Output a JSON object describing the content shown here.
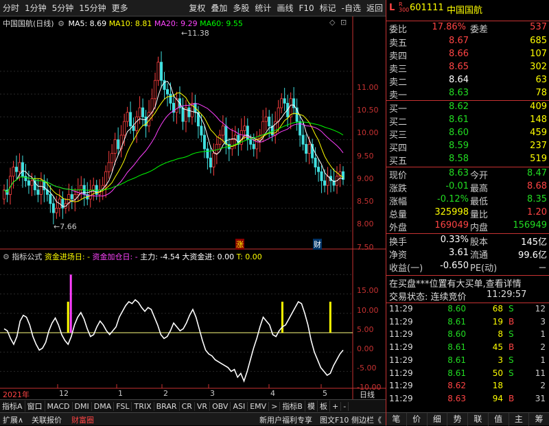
{
  "toolbar_left": [
    "分时",
    "1分钟",
    "5分钟",
    "15分钟",
    "更多"
  ],
  "toolbar_right": [
    "复权",
    "叠加",
    "多股",
    "统计",
    "画线",
    "F10",
    "标记",
    "-自选",
    "返回"
  ],
  "chart": {
    "name": "中国国航(日线)",
    "ma5_label": "MA5: 8.69",
    "ma10_label": "MA10: 8.81",
    "ma20_label": "MA20: 9.29",
    "ma60_label": "MA60: 9.55",
    "colors": {
      "ma5": "#ffffff",
      "ma10": "#ffff00",
      "ma20": "#ff40ff",
      "ma60": "#00ff00",
      "up": "#ff4040",
      "down": "#40e0e0"
    },
    "high_label": "11.38",
    "low_label": "7.66",
    "price_ticks": [
      "11.00",
      "10.50",
      "10.00",
      "9.50",
      "9.00",
      "8.50",
      "8.00",
      "7.50"
    ],
    "marker_zhang": "涨",
    "marker_cai": "财"
  },
  "chart_data": {
    "type": "candlestick",
    "ylim": [
      7.3,
      11.6
    ],
    "open": [
      8.2,
      8.4,
      8.3,
      8.7,
      8.9,
      8.8,
      9.0,
      8.7,
      8.6,
      8.5,
      8.6,
      8.4,
      8.3,
      8.6,
      8.4,
      8.3,
      8.1,
      7.9,
      8.0,
      8.2,
      8.0,
      8.1,
      8.3,
      8.2,
      8.3,
      8.4,
      8.5,
      8.3,
      8.2,
      8.4,
      8.5,
      8.3,
      8.4,
      8.5,
      8.8,
      9.0,
      9.2,
      9.5,
      9.3,
      9.6,
      9.9,
      10.1,
      9.8,
      9.7,
      10.0,
      10.2,
      10.0,
      9.8,
      10.1,
      10.4,
      10.8,
      11.2,
      10.8,
      10.6,
      10.5,
      10.3,
      10.1,
      10.4,
      10.2,
      9.9,
      10.2,
      10.0,
      10.3,
      10.1,
      9.8,
      9.6,
      9.3,
      9.1,
      8.9,
      9.2,
      9.4,
      9.6,
      9.8,
      9.4,
      9.3,
      9.5,
      9.6,
      9.4,
      9.7,
      9.8,
      9.5,
      9.4,
      9.3,
      9.5,
      9.6,
      9.9,
      10.0,
      9.8,
      9.6,
      9.9,
      10.2,
      10.4,
      10.3,
      10.0,
      10.4,
      10.2,
      9.9,
      9.6,
      9.4,
      9.2,
      9.4,
      9.1,
      8.9,
      8.8,
      8.6,
      8.5,
      8.7,
      8.6,
      8.5,
      8.7,
      8.8
    ],
    "close": [
      8.4,
      8.3,
      8.7,
      8.9,
      8.8,
      9.0,
      8.7,
      8.6,
      8.5,
      8.6,
      8.4,
      8.3,
      8.6,
      8.4,
      8.3,
      8.1,
      7.9,
      8.0,
      8.2,
      8.0,
      8.1,
      8.3,
      8.2,
      8.3,
      8.4,
      8.5,
      8.3,
      8.2,
      8.4,
      8.5,
      8.3,
      8.4,
      8.5,
      8.8,
      9.0,
      9.2,
      9.5,
      9.3,
      9.6,
      9.9,
      10.1,
      9.8,
      9.7,
      10.0,
      10.2,
      10.0,
      9.8,
      10.1,
      10.4,
      10.8,
      11.2,
      10.8,
      10.6,
      10.5,
      10.3,
      10.1,
      10.4,
      10.2,
      9.9,
      10.2,
      10.0,
      10.3,
      10.1,
      9.8,
      9.6,
      9.3,
      9.1,
      8.9,
      9.2,
      9.4,
      9.6,
      9.8,
      9.4,
      9.3,
      9.5,
      9.6,
      9.4,
      9.7,
      9.8,
      9.5,
      9.4,
      9.3,
      9.5,
      9.6,
      9.9,
      10.0,
      9.8,
      9.6,
      9.9,
      10.2,
      10.4,
      10.3,
      10.0,
      10.4,
      10.2,
      9.9,
      9.6,
      9.4,
      9.2,
      9.4,
      9.1,
      8.9,
      8.8,
      8.6,
      8.5,
      8.7,
      8.6,
      8.5,
      8.7,
      8.8,
      8.63
    ],
    "x_labels": [
      "2021年",
      "12",
      "1",
      "2",
      "3",
      "4",
      "5"
    ],
    "indicator_ticks": [
      "15.00",
      "10.00",
      "5.00",
      "0.00",
      "-5.00",
      "-10.00"
    ],
    "indicator_ylim": [
      -14,
      17
    ]
  },
  "indicator": {
    "name": "指标公式",
    "l1": "资金进场日: -",
    "l2": "资金加仓日: -",
    "l3": "主力: -4.54",
    "l4": "大资金进: 0.00",
    "l5": "T: 0.00",
    "osc": [
      1.0,
      0.5,
      -1.5,
      -3.0,
      -1.0,
      3.0,
      4.5,
      4.0,
      2.0,
      -1.0,
      -3.0,
      -4.5,
      -4.0,
      -2.5,
      0.5,
      2.5,
      3.8,
      2.0,
      -0.5,
      -2.0,
      -3.0,
      -1.0,
      2.0,
      4.0,
      5.2,
      3.5,
      1.0,
      -1.0,
      -0.5,
      1.5,
      3.0,
      2.0,
      0.5,
      -0.5,
      0.5,
      1.5,
      4.0,
      5.5,
      7.0,
      8.0,
      7.5,
      8.5,
      7.8,
      6.5,
      5.5,
      6.5,
      6.0,
      4.0,
      2.0,
      -0.5,
      -1.5,
      -1.0,
      0.5,
      2.5,
      1.5,
      0.5,
      1.0,
      2.5,
      4.5,
      6.0,
      4.0,
      1.0,
      -2.0,
      -4.5,
      -5.5,
      -6.0,
      -7.0,
      -7.5,
      -8.0,
      -8.5,
      -9.0,
      -10.0,
      -9.5,
      -11.5,
      -10.5,
      -12.5,
      -10.0,
      -7.0,
      -4.0,
      -1.5,
      1.5,
      4.0,
      3.0,
      2.0,
      -0.5,
      -1.0,
      0.5,
      1.5,
      2.0,
      3.5,
      5.0,
      6.5,
      8.0,
      7.5,
      5.0,
      2.0,
      -2.0,
      -5.0,
      -7.0,
      -9.0,
      -10.0,
      -11.0,
      -10.5,
      -8.5,
      -7.0,
      -5.5,
      -4.5
    ],
    "spikes": [
      {
        "i": 20,
        "m": 15,
        "y": 8
      },
      {
        "i": 87,
        "y": 8
      },
      {
        "i": 102,
        "y": 8
      }
    ]
  },
  "bottom_tabs": [
    "指标A",
    "窗口",
    "MACD",
    "DMI",
    "DMA",
    "FSL",
    "TRIX",
    "BRAR",
    "CR",
    "VR",
    "OBV",
    "ASI",
    "EMV",
    ">",
    "指标B",
    "模",
    "板",
    "+",
    "-"
  ],
  "bottom_right": "日线",
  "status": {
    "expand": "扩展∧",
    "watch": "关联报价",
    "fortune": "财富圈",
    "promo": "新用户福利专享",
    "f10": "图文F10",
    "side": "侧边栏《"
  },
  "right_nav": [
    "笔",
    "价",
    "细",
    "势",
    "联",
    "值",
    "主",
    "筹"
  ],
  "quote": {
    "code_prefix": "L",
    "r300": "R 300",
    "code": "601111",
    "name": "中国国航",
    "wb_label": "委比",
    "wb": "17.86%",
    "wc_label": "委差",
    "wc": "537",
    "sells": [
      {
        "l": "卖五",
        "p": "8.67",
        "v": "685"
      },
      {
        "l": "卖四",
        "p": "8.66",
        "v": "107"
      },
      {
        "l": "卖三",
        "p": "8.65",
        "v": "302"
      },
      {
        "l": "卖二",
        "p": "8.64",
        "v": "63"
      },
      {
        "l": "卖一",
        "p": "8.63",
        "v": "78"
      }
    ],
    "buys": [
      {
        "l": "买一",
        "p": "8.62",
        "v": "409"
      },
      {
        "l": "买二",
        "p": "8.61",
        "v": "148"
      },
      {
        "l": "买三",
        "p": "8.60",
        "v": "459"
      },
      {
        "l": "买四",
        "p": "8.59",
        "v": "237"
      },
      {
        "l": "买五",
        "p": "8.58",
        "v": "519"
      }
    ],
    "stats": [
      {
        "l1": "现价",
        "v1": "8.63",
        "c1": "grn",
        "l2": "今开",
        "v2": "8.47",
        "c2": "grn"
      },
      {
        "l1": "涨跌",
        "v1": "-0.01",
        "c1": "grn",
        "l2": "最高",
        "v2": "8.68",
        "c2": "red"
      },
      {
        "l1": "涨幅",
        "v1": "-0.12%",
        "c1": "grn",
        "l2": "最低",
        "v2": "8.35",
        "c2": "grn"
      },
      {
        "l1": "总量",
        "v1": "325998",
        "c1": "yel",
        "l2": "量比",
        "v2": "1.20",
        "c2": "red"
      },
      {
        "l1": "外盘",
        "v1": "169049",
        "c1": "red",
        "l2": "内盘",
        "v2": "156949",
        "c2": "grn"
      }
    ],
    "stats2": [
      {
        "l1": "换手",
        "v1": "0.33%",
        "l2": "股本",
        "v2": "145亿"
      },
      {
        "l1": "净资",
        "v1": "3.61",
        "l2": "流通",
        "v2": "99.6亿"
      },
      {
        "l1": "收益(一)",
        "v1": "-0.650",
        "l2": "PE(动)",
        "v2": "－"
      }
    ],
    "notice": "在买盘***位置有大买单,查看详情",
    "state_label": "交易状态: 连续竞价",
    "state_time": "11:29:57",
    "ticks": [
      {
        "t": "11:29",
        "p": "8.60",
        "v": "68",
        "s": "S",
        "n": "12"
      },
      {
        "t": "11:29",
        "p": "8.61",
        "v": "19",
        "s": "B",
        "n": "3"
      },
      {
        "t": "11:29",
        "p": "8.60",
        "v": "8",
        "s": "S",
        "n": "1"
      },
      {
        "t": "11:29",
        "p": "8.61",
        "v": "45",
        "s": "B",
        "n": "2"
      },
      {
        "t": "11:29",
        "p": "8.61",
        "v": "3",
        "s": "S",
        "n": "1"
      },
      {
        "t": "11:29",
        "p": "8.61",
        "v": "50",
        "s": "S",
        "n": "11"
      },
      {
        "t": "11:29",
        "p": "8.62",
        "v": "18",
        "s": "",
        "n": "2"
      },
      {
        "t": "11:29",
        "p": "8.63",
        "v": "94",
        "s": "B",
        "n": "31"
      }
    ]
  }
}
